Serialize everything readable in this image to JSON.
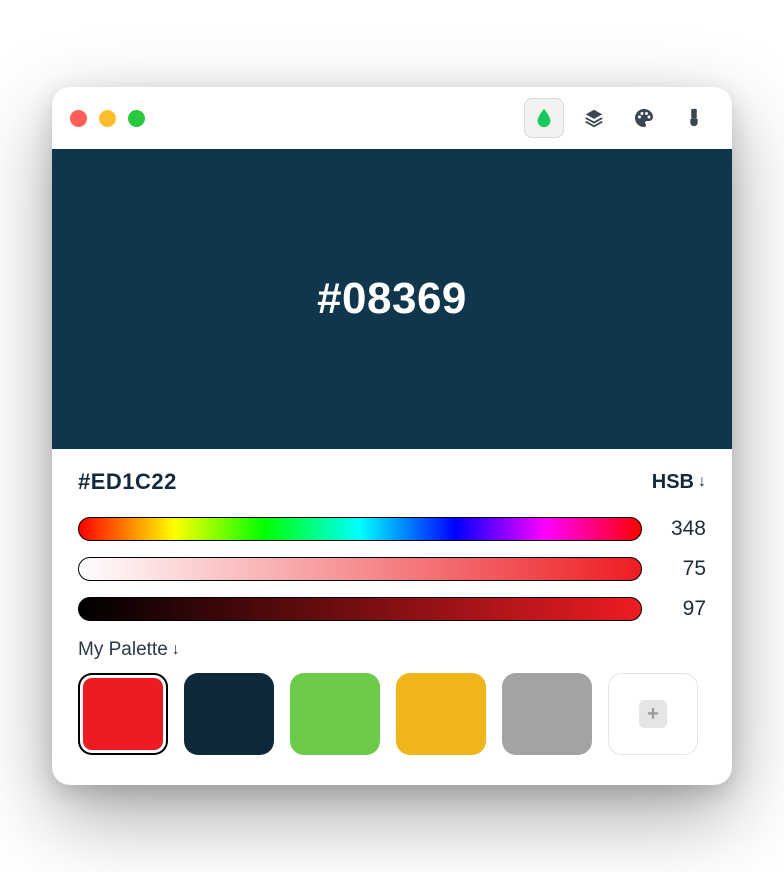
{
  "preview": {
    "hex_display": "#08369",
    "background": "#0f364c"
  },
  "current_hex": "#ED1C22",
  "mode": "HSB",
  "sliders": {
    "hue": 348,
    "saturation": 75,
    "brightness": 97
  },
  "palette": {
    "title": "My Palette",
    "colors": [
      "#ED1C22",
      "#0e2a3a",
      "#6cca4a",
      "#f1b51c",
      "#a3a3a3"
    ]
  },
  "icons": {
    "drop": "drop-icon",
    "layers": "layers-icon",
    "palette": "palette-icon",
    "brush": "brush-icon",
    "add": "+"
  }
}
